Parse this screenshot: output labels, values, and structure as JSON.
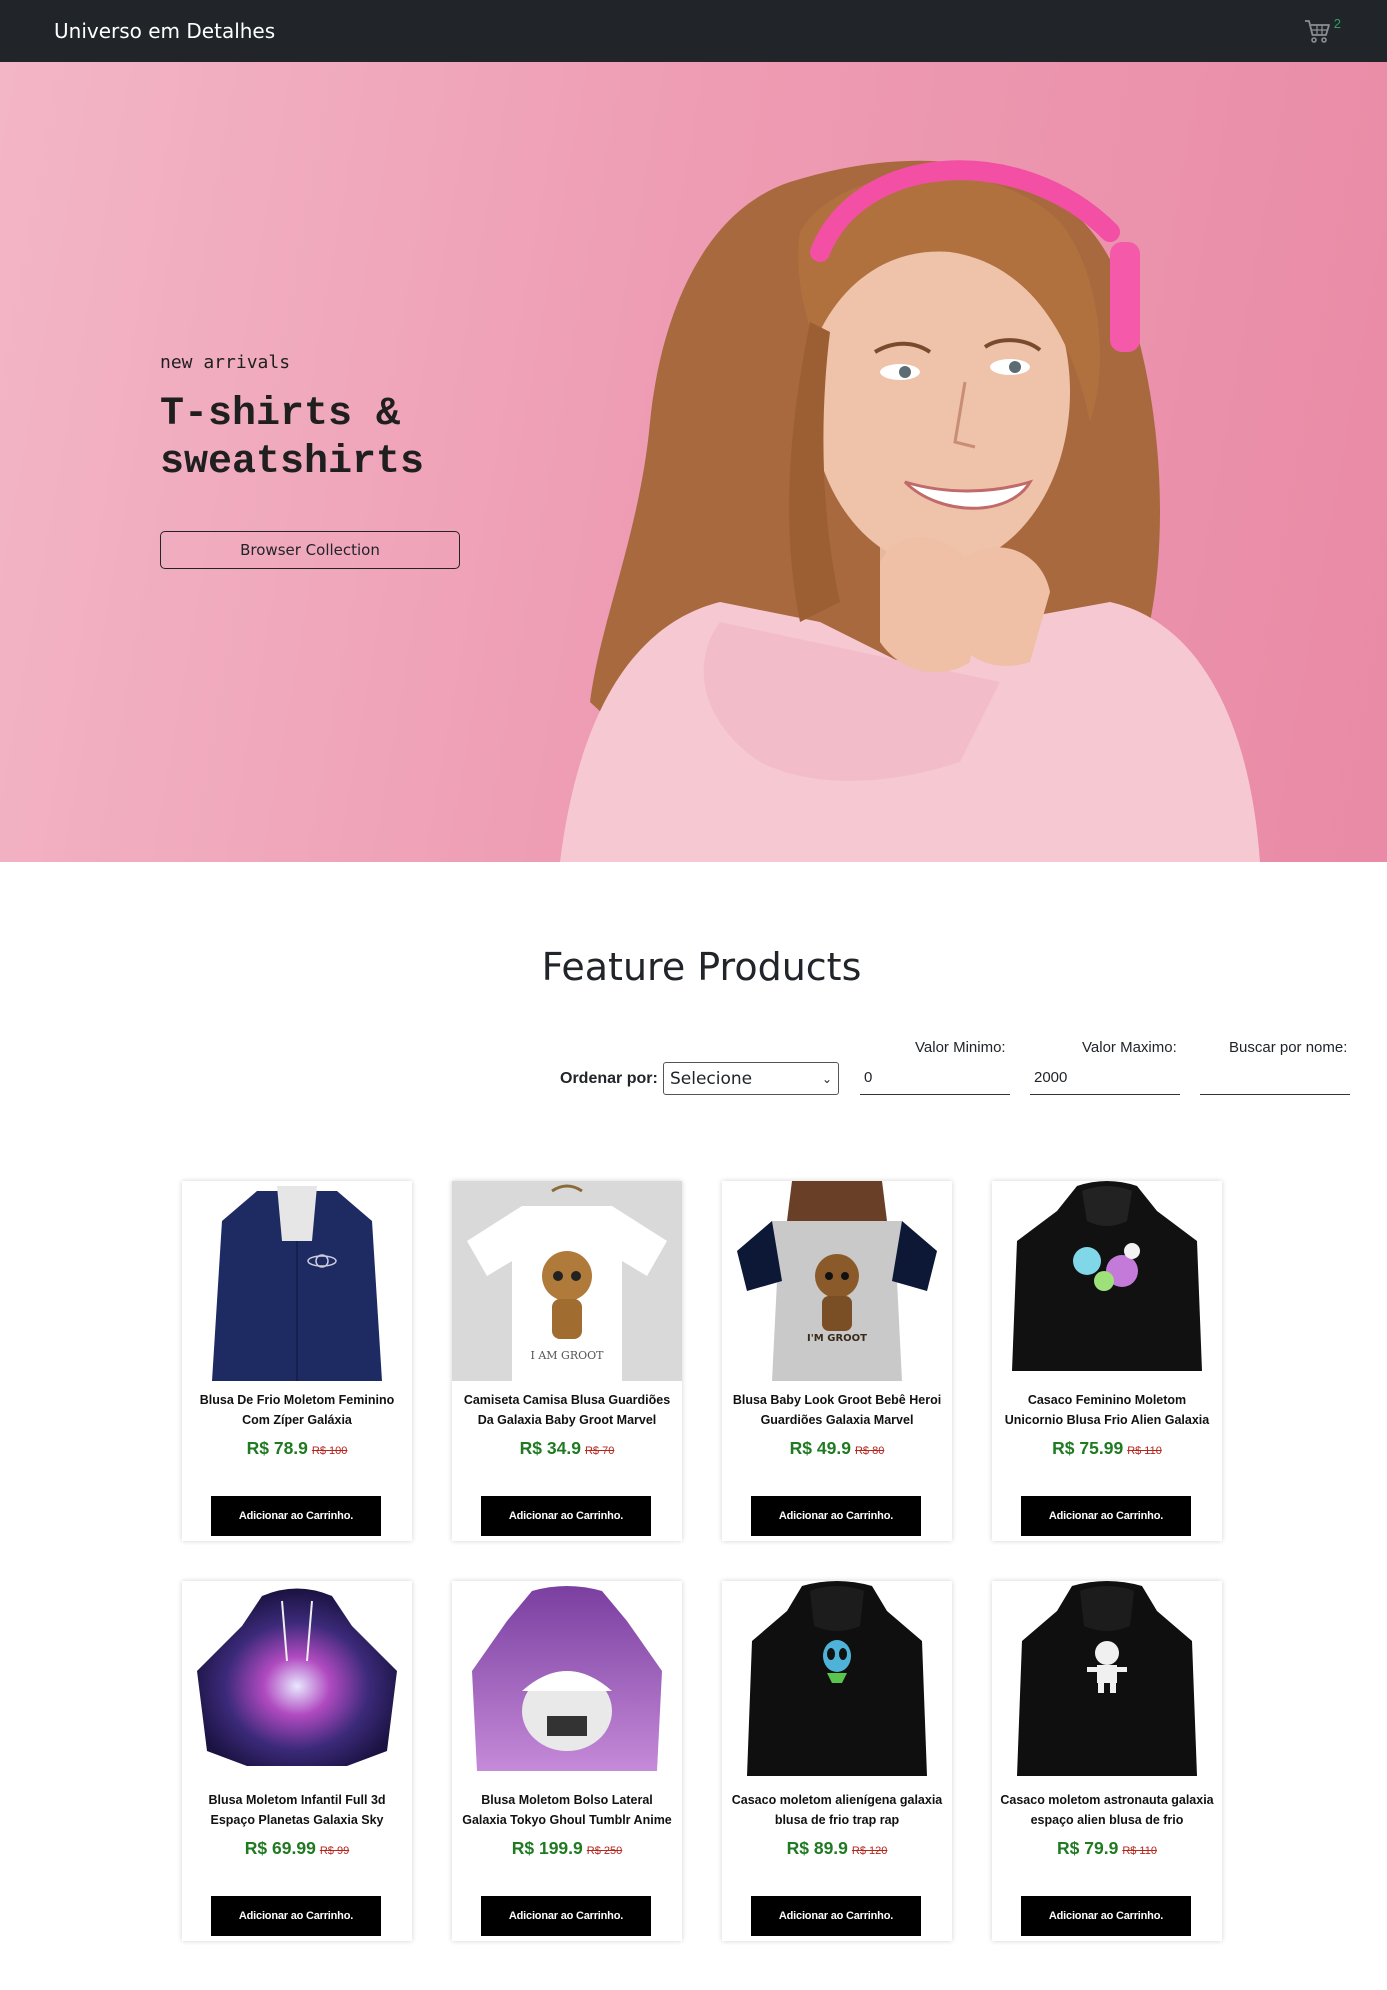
{
  "navbar": {
    "brand": "Universo em Detalhes",
    "cart_icon": "shopping-cart-icon",
    "cart_count": "2"
  },
  "hero": {
    "subtitle": "new arrivals",
    "title": "T-shirts & sweatshirts",
    "button_label": "Browser Collection",
    "background_color": "#ee9db4"
  },
  "feature": {
    "title": "Feature Products"
  },
  "filters": {
    "order_label": "Ordenar por:",
    "order_selected": "Selecione",
    "min_label": "Valor Minimo:",
    "min_value": "0",
    "max_label": "Valor Maximo:",
    "max_value": "2000",
    "name_label": "Buscar por nome:",
    "name_value": ""
  },
  "products": [
    {
      "name": "Blusa De Frio Moletom Feminino Com Zíper Galáxia",
      "price": "R$ 78.9",
      "old_price": "R$ 100",
      "button": "Adicionar ao Carrinho."
    },
    {
      "name": "Camiseta Camisa Blusa Guardiões Da Galaxia Baby Groot Marvel",
      "price": "R$ 34.9",
      "old_price": "R$ 70",
      "button": "Adicionar ao Carrinho."
    },
    {
      "name": "Blusa Baby Look Groot Bebê Heroi Guardiões Galaxia Marvel",
      "price": "R$ 49.9",
      "old_price": "R$ 80",
      "button": "Adicionar ao Carrinho."
    },
    {
      "name": "Casaco Feminino Moletom Unicornio Blusa Frio Alien Galaxia",
      "price": "R$ 75.99",
      "old_price": "R$ 110",
      "button": "Adicionar ao Carrinho."
    },
    {
      "name": "Blusa Moletom Infantil Full 3d Espaço Planetas Galaxia Sky",
      "price": "R$ 69.99",
      "old_price": "R$ 99",
      "button": "Adicionar ao Carrinho."
    },
    {
      "name": "Blusa Moletom Bolso Lateral Galaxia Tokyo Ghoul Tumblr Anime",
      "price": "R$ 199.9",
      "old_price": "R$ 250",
      "button": "Adicionar ao Carrinho."
    },
    {
      "name": "Casaco moletom alienígena galaxia blusa de frio trap rap",
      "price": "R$ 89.9",
      "old_price": "R$ 120",
      "button": "Adicionar ao Carrinho."
    },
    {
      "name": "Casaco moletom astronauta galaxia espaço alien blusa de frio",
      "price": "R$ 79.9",
      "old_price": "R$ 110",
      "button": "Adicionar ao Carrinho."
    }
  ]
}
